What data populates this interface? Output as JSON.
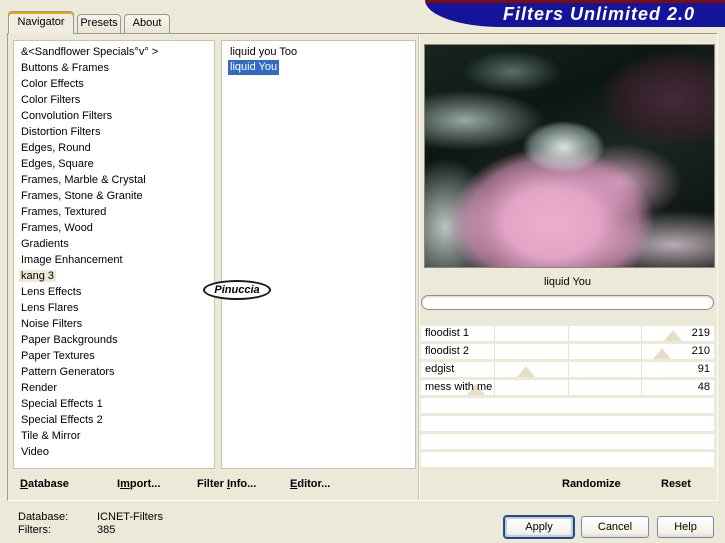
{
  "title_bar": {
    "title": "Filters Unlimited 2.0"
  },
  "tabs": [
    {
      "label": "Navigator",
      "active": true
    },
    {
      "label": "Presets",
      "active": false
    },
    {
      "label": "About",
      "active": false
    }
  ],
  "categories": {
    "items": [
      {
        "label": "&<Sandflower Specials°v° >"
      },
      {
        "label": "Buttons & Frames"
      },
      {
        "label": "Color Effects"
      },
      {
        "label": "Color Filters"
      },
      {
        "label": "Convolution Filters"
      },
      {
        "label": "Distortion Filters"
      },
      {
        "label": "Edges, Round"
      },
      {
        "label": "Edges, Square"
      },
      {
        "label": "Frames, Marble & Crystal"
      },
      {
        "label": "Frames, Stone & Granite"
      },
      {
        "label": "Frames, Textured"
      },
      {
        "label": "Frames, Wood"
      },
      {
        "label": "Gradients"
      },
      {
        "label": "Image Enhancement"
      },
      {
        "label": "kang 3",
        "highlight": true
      },
      {
        "label": "Lens Effects"
      },
      {
        "label": "Lens Flares"
      },
      {
        "label": "Noise Filters"
      },
      {
        "label": "Paper Backgrounds"
      },
      {
        "label": "Paper Textures"
      },
      {
        "label": "Pattern Generators"
      },
      {
        "label": "Render"
      },
      {
        "label": "Special Effects 1"
      },
      {
        "label": "Special Effects 2"
      },
      {
        "label": "Tile & Mirror"
      },
      {
        "label": "Video"
      }
    ]
  },
  "filters_list": {
    "items": [
      {
        "label": "liquid you Too"
      },
      {
        "label": "liquid You",
        "selected": true
      }
    ]
  },
  "watermark": {
    "label": "Pinuccia"
  },
  "preview": {
    "selected_filter_label": "liquid You"
  },
  "sliders": [
    {
      "label": "floodist 1",
      "value": 219,
      "max": 255
    },
    {
      "label": "floodist 2",
      "value": 210,
      "max": 255
    },
    {
      "label": "edgist",
      "value": 91,
      "max": 255
    },
    {
      "label": "mess with me",
      "value": 48,
      "max": 255
    }
  ],
  "actions": {
    "database": {
      "pre": "",
      "u": "D",
      "post": "atabase"
    },
    "import": {
      "pre": "I",
      "u": "m",
      "post": "port..."
    },
    "filter_info": {
      "pre": "Filter ",
      "u": "I",
      "post": "nfo..."
    },
    "editor": {
      "pre": "",
      "u": "E",
      "post": "ditor..."
    },
    "randomize": "Randomize",
    "reset": "Reset"
  },
  "status": {
    "database_label": "Database:",
    "database_value": "ICNET-Filters",
    "filters_label": "Filters:",
    "filters_value": "385"
  },
  "dialog_buttons": [
    {
      "label": "Apply"
    },
    {
      "label": "Cancel"
    },
    {
      "label": "Help"
    }
  ],
  "colors": {
    "dialog_background": "#ECE9D8",
    "banner_blue": "#14149B",
    "banner_red_line": "#7B0D12",
    "selection_blue": "#316AC5",
    "category_highlight": "#EFEAD6",
    "slider_marker_tan": "#E7DFC5",
    "tab_accent_orange": "#F2A20C"
  }
}
